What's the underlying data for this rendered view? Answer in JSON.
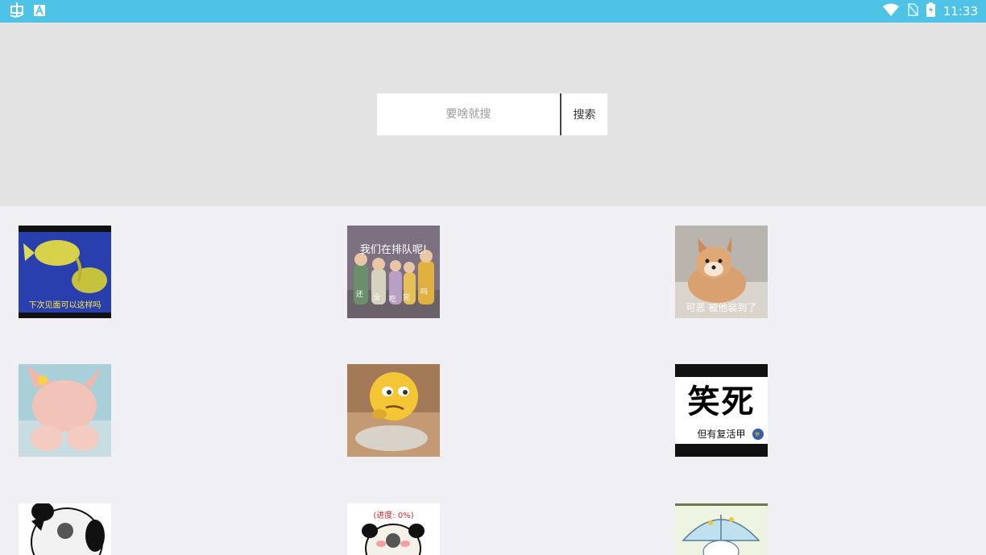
{
  "status_bar": {
    "time": "11:33",
    "icons": [
      "app-bug-icon",
      "text-a-icon",
      "wifi-icon",
      "no-sim-icon",
      "battery-charging-icon"
    ]
  },
  "search": {
    "placeholder": "要啥就搜",
    "button_label": "搜索"
  },
  "stickers": [
    {
      "caption": "下次见面可以这样吗"
    },
    {
      "caption": "我们在排队呢!",
      "tags": [
        "还",
        "没",
        "吃",
        "完",
        "吗"
      ]
    },
    {
      "caption": "可恶 被他装到了"
    },
    {
      "caption": ""
    },
    {
      "caption": ""
    },
    {
      "caption_big": "笑死",
      "caption": "但有复活甲"
    },
    {
      "caption": ""
    },
    {
      "caption": "(进度: 0%)"
    },
    {
      "caption": ""
    }
  ]
}
